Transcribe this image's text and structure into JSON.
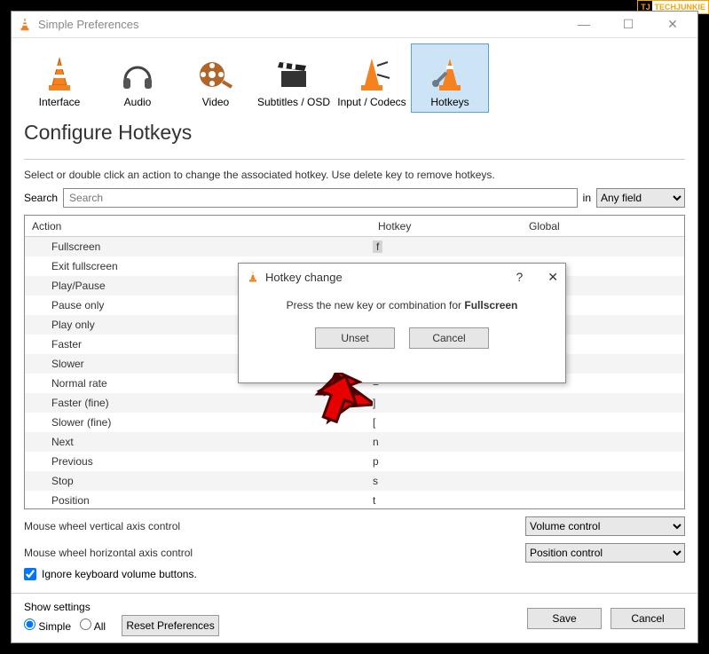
{
  "watermark": {
    "badge": "TJ",
    "text": "TECHJUNKIE"
  },
  "window": {
    "title": "Simple Preferences",
    "minimize": "—",
    "maximize": "☐",
    "close": "✕"
  },
  "categories": [
    {
      "label": "Interface"
    },
    {
      "label": "Audio"
    },
    {
      "label": "Video"
    },
    {
      "label": "Subtitles / OSD"
    },
    {
      "label": "Input / Codecs"
    },
    {
      "label": "Hotkeys"
    }
  ],
  "page_title": "Configure Hotkeys",
  "instruction": "Select or double click an action to change the associated hotkey. Use delete key to remove hotkeys.",
  "search": {
    "label": "Search",
    "placeholder": "Search",
    "in_label": "in",
    "field_option": "Any field"
  },
  "columns": {
    "action": "Action",
    "hotkey": "Hotkey",
    "global": "Global"
  },
  "rows": [
    {
      "action": "Fullscreen",
      "hotkey": "f",
      "selected": true
    },
    {
      "action": "Exit fullscreen",
      "hotkey": ""
    },
    {
      "action": "Play/Pause",
      "hotkey": ""
    },
    {
      "action": "Pause only",
      "hotkey": ""
    },
    {
      "action": "Play only",
      "hotkey": ""
    },
    {
      "action": "Faster",
      "hotkey": ""
    },
    {
      "action": "Slower",
      "hotkey": ""
    },
    {
      "action": "Normal rate",
      "hotkey": "="
    },
    {
      "action": "Faster (fine)",
      "hotkey": "]"
    },
    {
      "action": "Slower (fine)",
      "hotkey": "["
    },
    {
      "action": "Next",
      "hotkey": "n"
    },
    {
      "action": "Previous",
      "hotkey": "p"
    },
    {
      "action": "Stop",
      "hotkey": "s"
    },
    {
      "action": "Position",
      "hotkey": "t"
    }
  ],
  "wheel_v": {
    "label": "Mouse wheel vertical axis control",
    "value": "Volume control"
  },
  "wheel_h": {
    "label": "Mouse wheel horizontal axis control",
    "value": "Position control"
  },
  "ignore_kb": {
    "label": "Ignore keyboard volume buttons.",
    "checked": true
  },
  "footer": {
    "show_label": "Show settings",
    "simple": "Simple",
    "all": "All",
    "reset": "Reset Preferences",
    "save": "Save",
    "cancel": "Cancel"
  },
  "dialog": {
    "title": "Hotkey change",
    "help": "?",
    "close": "✕",
    "prompt_prefix": "Press the new key or combination for ",
    "prompt_target": "Fullscreen",
    "unset": "Unset",
    "cancel": "Cancel"
  }
}
